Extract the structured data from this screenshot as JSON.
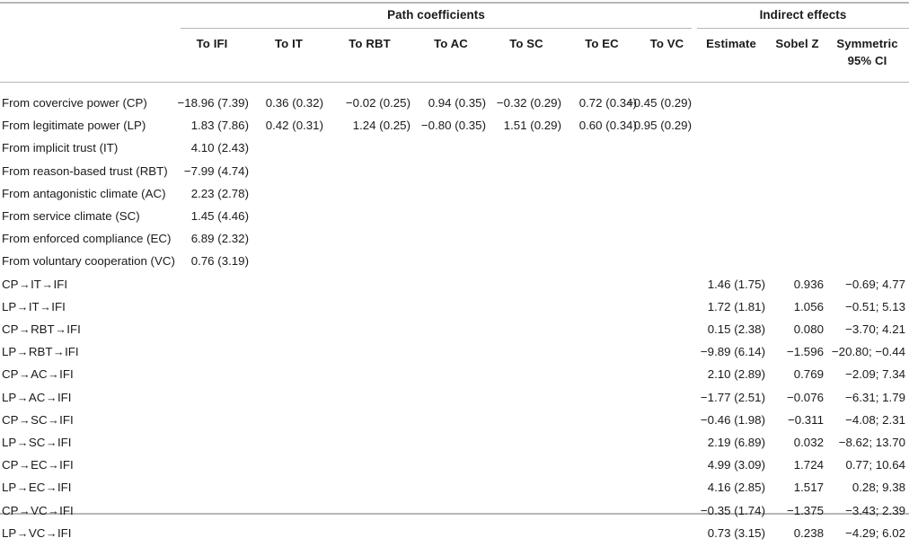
{
  "table": {
    "groups": [
      {
        "name": "path-coefficients-group",
        "label": "Path coefficients"
      },
      {
        "name": "indirect-effects-group",
        "label": "Indirect effects"
      }
    ],
    "columns": [
      {
        "name": "row-label",
        "label": ""
      },
      {
        "name": "to-ifi",
        "label": "To IFI"
      },
      {
        "name": "to-it",
        "label": "To IT"
      },
      {
        "name": "to-rbt",
        "label": "To RBT"
      },
      {
        "name": "to-ac",
        "label": "To AC"
      },
      {
        "name": "to-sc",
        "label": "To SC"
      },
      {
        "name": "to-ec",
        "label": "To EC"
      },
      {
        "name": "to-vc",
        "label": "To VC"
      },
      {
        "name": "estimate",
        "label": "Estimate"
      },
      {
        "name": "sobel-z",
        "label": "Sobel Z"
      },
      {
        "name": "symmetric-ci",
        "label": "Symmetric",
        "label_line2": "95% CI"
      }
    ],
    "rows": [
      {
        "label": "From covercive power (CP)",
        "to_ifi": "−18.96 (7.39)",
        "to_it": "0.36 (0.32)",
        "to_rbt": "−0.02 (0.25)",
        "to_ac": "0.94 (0.35)",
        "to_sc": "−0.32 (0.29)",
        "to_ec": "0.72 (0.34)",
        "to_vc": "−0.45 (0.29)",
        "estimate": "",
        "sobel_z": "",
        "ci": ""
      },
      {
        "label": "From legitimate power (LP)",
        "to_ifi": "1.83 (7.86)",
        "to_it": "0.42 (0.31)",
        "to_rbt": "1.24 (0.25)",
        "to_ac": "−0.80 (0.35)",
        "to_sc": "1.51 (0.29)",
        "to_ec": "0.60 (0.34)",
        "to_vc": "0.95 (0.29)",
        "estimate": "",
        "sobel_z": "",
        "ci": ""
      },
      {
        "label": "From implicit trust (IT)",
        "to_ifi": "4.10 (2.43)",
        "to_it": "",
        "to_rbt": "",
        "to_ac": "",
        "to_sc": "",
        "to_ec": "",
        "to_vc": "",
        "estimate": "",
        "sobel_z": "",
        "ci": ""
      },
      {
        "label": "From reason-based trust (RBT)",
        "to_ifi": "−7.99 (4.74)",
        "to_it": "",
        "to_rbt": "",
        "to_ac": "",
        "to_sc": "",
        "to_ec": "",
        "to_vc": "",
        "estimate": "",
        "sobel_z": "",
        "ci": ""
      },
      {
        "label": "From antagonistic climate (AC)",
        "to_ifi": "2.23 (2.78)",
        "to_it": "",
        "to_rbt": "",
        "to_ac": "",
        "to_sc": "",
        "to_ec": "",
        "to_vc": "",
        "estimate": "",
        "sobel_z": "",
        "ci": ""
      },
      {
        "label": "From service climate (SC)",
        "to_ifi": "1.45 (4.46)",
        "to_it": "",
        "to_rbt": "",
        "to_ac": "",
        "to_sc": "",
        "to_ec": "",
        "to_vc": "",
        "estimate": "",
        "sobel_z": "",
        "ci": ""
      },
      {
        "label": "From enforced compliance (EC)",
        "to_ifi": "6.89 (2.32)",
        "to_it": "",
        "to_rbt": "",
        "to_ac": "",
        "to_sc": "",
        "to_ec": "",
        "to_vc": "",
        "estimate": "",
        "sobel_z": "",
        "ci": ""
      },
      {
        "label": "From voluntary cooperation (VC)",
        "to_ifi": "0.76 (3.19)",
        "to_it": "",
        "to_rbt": "",
        "to_ac": "",
        "to_sc": "",
        "to_ec": "",
        "to_vc": "",
        "estimate": "",
        "sobel_z": "",
        "ci": ""
      },
      {
        "label": "CP→IT→IFI",
        "to_ifi": "",
        "to_it": "",
        "to_rbt": "",
        "to_ac": "",
        "to_sc": "",
        "to_ec": "",
        "to_vc": "",
        "estimate": "1.46 (1.75)",
        "sobel_z": "0.936",
        "ci": "−0.69; 4.77"
      },
      {
        "label": "LP→IT→IFI",
        "to_ifi": "",
        "to_it": "",
        "to_rbt": "",
        "to_ac": "",
        "to_sc": "",
        "to_ec": "",
        "to_vc": "",
        "estimate": "1.72 (1.81)",
        "sobel_z": "1.056",
        "ci": "−0.51; 5.13"
      },
      {
        "label": "CP→RBT→IFI",
        "to_ifi": "",
        "to_it": "",
        "to_rbt": "",
        "to_ac": "",
        "to_sc": "",
        "to_ec": "",
        "to_vc": "",
        "estimate": "0.15 (2.38)",
        "sobel_z": "0.080",
        "ci": "−3.70; 4.21"
      },
      {
        "label": "LP→RBT→IFI",
        "to_ifi": "",
        "to_it": "",
        "to_rbt": "",
        "to_ac": "",
        "to_sc": "",
        "to_ec": "",
        "to_vc": "",
        "estimate": "−9.89 (6.14)",
        "sobel_z": "−1.596",
        "ci": "−20.80; −0.44"
      },
      {
        "label": "CP→AC→IFI",
        "to_ifi": "",
        "to_it": "",
        "to_rbt": "",
        "to_ac": "",
        "to_sc": "",
        "to_ec": "",
        "to_vc": "",
        "estimate": "2.10 (2.89)",
        "sobel_z": "0.769",
        "ci": "−2.09; 7.34"
      },
      {
        "label": "LP→AC→IFI",
        "to_ifi": "",
        "to_it": "",
        "to_rbt": "",
        "to_ac": "",
        "to_sc": "",
        "to_ec": "",
        "to_vc": "",
        "estimate": "−1.77 (2.51)",
        "sobel_z": "−0.076",
        "ci": "−6.31; 1.79"
      },
      {
        "label": "CP→SC→IFI",
        "to_ifi": "",
        "to_it": "",
        "to_rbt": "",
        "to_ac": "",
        "to_sc": "",
        "to_ec": "",
        "to_vc": "",
        "estimate": "−0.46 (1.98)",
        "sobel_z": "−0.311",
        "ci": "−4.08; 2.31"
      },
      {
        "label": "LP→SC→IFI",
        "to_ifi": "",
        "to_it": "",
        "to_rbt": "",
        "to_ac": "",
        "to_sc": "",
        "to_ec": "",
        "to_vc": "",
        "estimate": "2.19 (6.89)",
        "sobel_z": "0.032",
        "ci": "−8.62; 13.70"
      },
      {
        "label": "CP→EC→IFI",
        "to_ifi": "",
        "to_it": "",
        "to_rbt": "",
        "to_ac": "",
        "to_sc": "",
        "to_ec": "",
        "to_vc": "",
        "estimate": "4.99 (3.09)",
        "sobel_z": "1.724",
        "ci": "0.77; 10.64"
      },
      {
        "label": "LP→EC→IFI",
        "to_ifi": "",
        "to_it": "",
        "to_rbt": "",
        "to_ac": "",
        "to_sc": "",
        "to_ec": "",
        "to_vc": "",
        "estimate": "4.16 (2.85)",
        "sobel_z": "1.517",
        "ci": "0.28; 9.38"
      },
      {
        "label": "CP→VC→IFI",
        "to_ifi": "",
        "to_it": "",
        "to_rbt": "",
        "to_ac": "",
        "to_sc": "",
        "to_ec": "",
        "to_vc": "",
        "estimate": "−0.35 (1.74)",
        "sobel_z": "−1.375",
        "ci": "−3.43; 2.39"
      },
      {
        "label": "LP→VC→IFI",
        "to_ifi": "",
        "to_it": "",
        "to_rbt": "",
        "to_ac": "",
        "to_sc": "",
        "to_ec": "",
        "to_vc": "",
        "estimate": "0.73 (3.15)",
        "sobel_z": "0.238",
        "ci": "−4.29; 6.02"
      }
    ]
  },
  "colors": {
    "rule": "#b7b7b7",
    "text": "#1a1a1a",
    "background": "#ffffff"
  }
}
